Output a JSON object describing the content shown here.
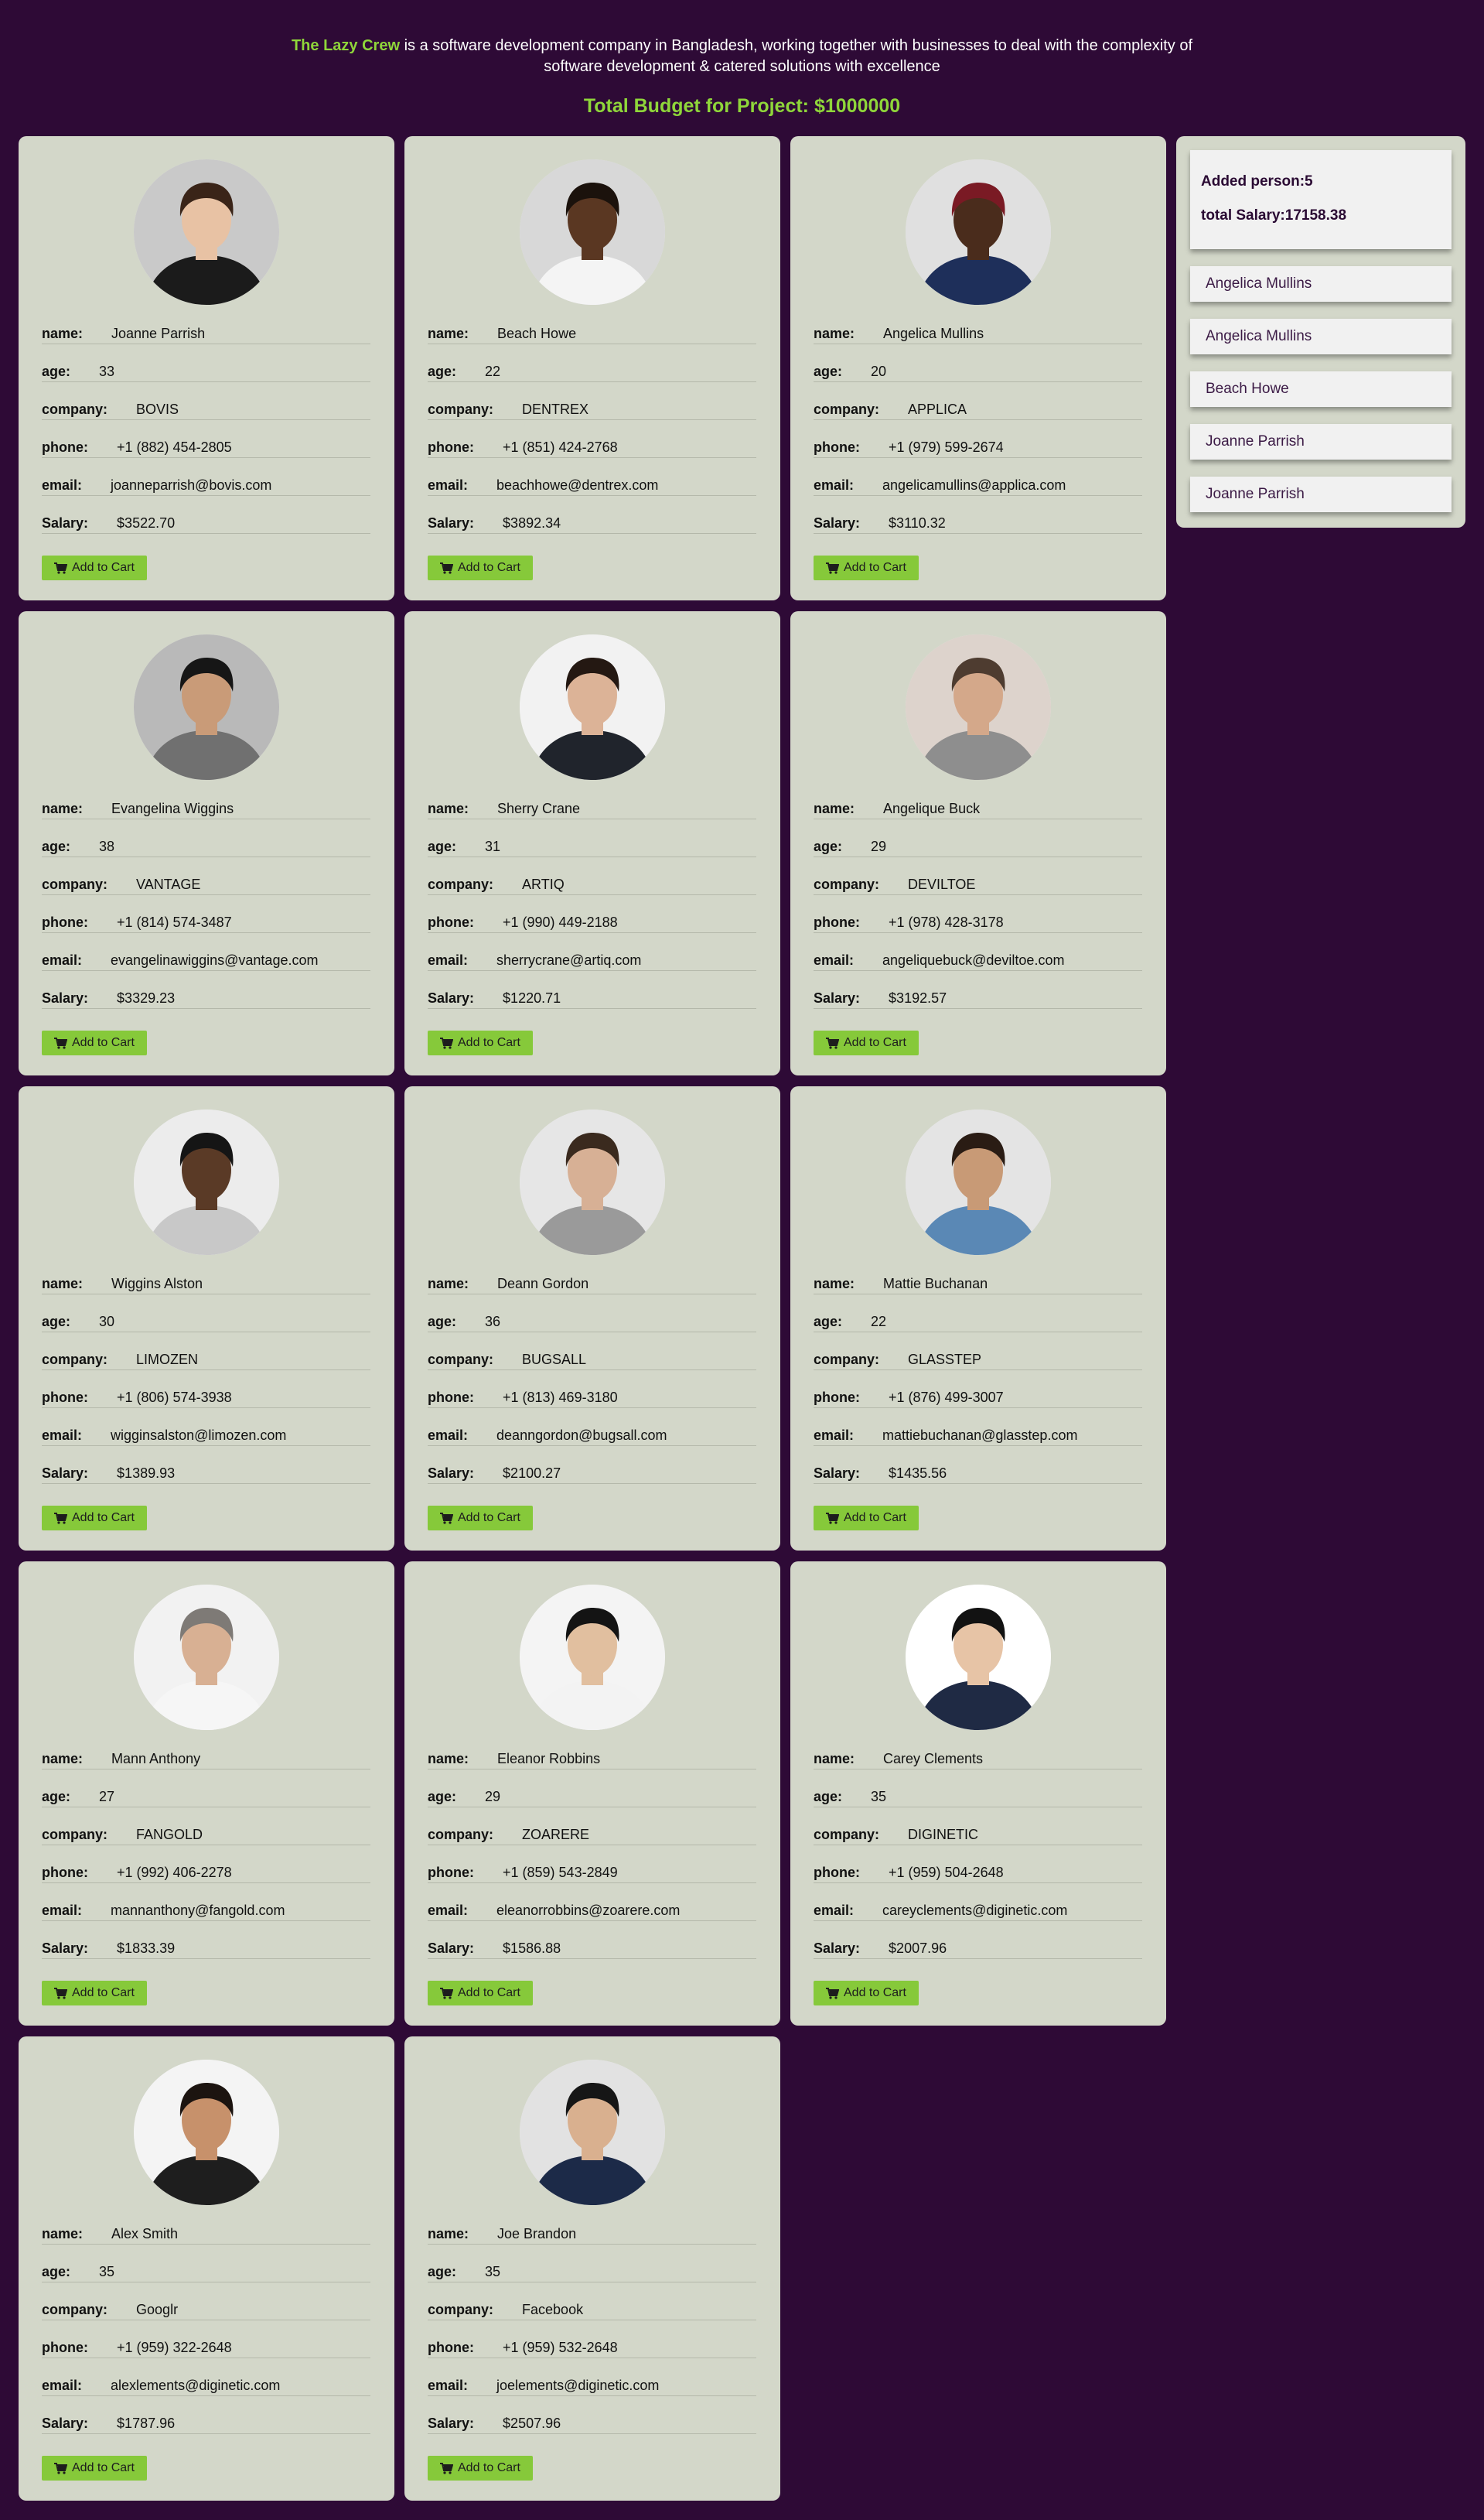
{
  "header": {
    "brand": "The Lazy Crew",
    "intro_text": " is a software development company in Bangladesh, working together with businesses to deal with the complexity of software development & catered solutions with excellence",
    "budget": "Total Budget for Project: $1000000"
  },
  "labels": {
    "name": "name:",
    "age": "age:",
    "company": "company:",
    "phone": "phone:",
    "email": "email:",
    "salary": "Salary:",
    "add_to_cart": "Add to Cart"
  },
  "people": [
    {
      "name": "Joanne Parrish",
      "age": "33",
      "company": "BOVIS",
      "phone": "+1 (882) 454-2805",
      "email": "joanneparrish@bovis.com",
      "salary": "$3522.70",
      "skin": "#e8c2a4",
      "hair": "#3a2418",
      "shirt": "#1b1b1b",
      "bg": "#c9c9c9"
    },
    {
      "name": "Beach Howe",
      "age": "22",
      "company": "DENTREX",
      "phone": "+1 (851) 424-2768",
      "email": "beachhowe@dentrex.com",
      "salary": "$3892.34",
      "skin": "#5a3722",
      "hair": "#1b120c",
      "shirt": "#f4f4f4",
      "bg": "#d8d8d8"
    },
    {
      "name": "Angelica Mullins",
      "age": "20",
      "company": "APPLICA",
      "phone": "+1 (979) 599-2674",
      "email": "angelicamullins@applica.com",
      "salary": "$3110.32",
      "skin": "#4a2c1c",
      "hair": "#7a1a24",
      "shirt": "#1e2f5a",
      "bg": "#e0e0e0"
    },
    {
      "name": "Evangelina Wiggins",
      "age": "38",
      "company": "VANTAGE",
      "phone": "+1 (814) 574-3487",
      "email": "evangelinawiggins@vantage.com",
      "salary": "$3329.23",
      "skin": "#c99b78",
      "hair": "#161616",
      "shirt": "#707070",
      "bg": "#b9b9b9"
    },
    {
      "name": "Sherry Crane",
      "age": "31",
      "company": "ARTIQ",
      "phone": "+1 (990) 449-2188",
      "email": "sherrycrane@artiq.com",
      "salary": "$1220.71",
      "skin": "#dcb397",
      "hair": "#241812",
      "shirt": "#20242c",
      "bg": "#f2f2f2"
    },
    {
      "name": "Angelique Buck",
      "age": "29",
      "company": "DEVILTOE",
      "phone": "+1 (978) 428-3178",
      "email": "angeliquebuck@deviltoe.com",
      "salary": "$3192.57",
      "skin": "#d4a88a",
      "hair": "#4e3c30",
      "shirt": "#8e8e8e",
      "bg": "#ddd3cc"
    },
    {
      "name": "Wiggins Alston",
      "age": "30",
      "company": "LIMOZEN",
      "phone": "+1 (806) 574-3938",
      "email": "wigginsalston@limozen.com",
      "salary": "$1389.93",
      "skin": "#5a3a26",
      "hair": "#151515",
      "shirt": "#c8c8c8",
      "bg": "#ececec"
    },
    {
      "name": "Deann Gordon",
      "age": "36",
      "company": "BUGSALL",
      "phone": "+1 (813) 469-3180",
      "email": "deanngordon@bugsall.com",
      "salary": "$2100.27",
      "skin": "#d7b095",
      "hair": "#3a2a1e",
      "shirt": "#9a9a9a",
      "bg": "#e6e6e6"
    },
    {
      "name": "Mattie Buchanan",
      "age": "22",
      "company": "GLASSTEP",
      "phone": "+1 (876) 499-3007",
      "email": "mattiebuchanan@glasstep.com",
      "salary": "$1435.56",
      "skin": "#c89a76",
      "hair": "#2a1c14",
      "shirt": "#5a88b5",
      "bg": "#e4e4e4"
    },
    {
      "name": "Mann Anthony",
      "age": "27",
      "company": "FANGOLD",
      "phone": "+1 (992) 406-2278",
      "email": "mannanthony@fangold.com",
      "salary": "$1833.39",
      "skin": "#d8b093",
      "hair": "#7e7a76",
      "shirt": "#f6f6f6",
      "bg": "#f2f2f2"
    },
    {
      "name": "Eleanor Robbins",
      "age": "29",
      "company": "ZOARERE",
      "phone": "+1 (859) 543-2849",
      "email": "eleanorrobbins@zoarere.com",
      "salary": "$1586.88",
      "skin": "#e1bf9f",
      "hair": "#141414",
      "shirt": "#f3f3f3",
      "bg": "#f4f4f4"
    },
    {
      "name": "Carey Clements",
      "age": "35",
      "company": "DIGINETIC",
      "phone": "+1 (959) 504-2648",
      "email": "careyclements@diginetic.com",
      "salary": "$2007.96",
      "skin": "#e7c4a6",
      "hair": "#121212",
      "shirt": "#1f2a44",
      "bg": "#ffffff"
    },
    {
      "name": "Alex Smith",
      "age": "35",
      "company": "Googlr",
      "phone": "+1 (959) 322-2648",
      "email": "alexlements@diginetic.com",
      "salary": "$1787.96",
      "skin": "#c7916b",
      "hair": "#1c1410",
      "shirt": "#1e1e1e",
      "bg": "#f4f4f4"
    },
    {
      "name": "Joe Brandon",
      "age": "35",
      "company": "Facebook",
      "phone": "+1 (959) 532-2648",
      "email": "joelements@diginetic.com",
      "salary": "$2507.96",
      "skin": "#d9b08f",
      "hair": "#161616",
      "shirt": "#1c2a48",
      "bg": "#e2e2e2"
    }
  ],
  "sidebar": {
    "added_person": "Added person:5",
    "total_salary": "total Salary:17158.38",
    "added": [
      "Angelica Mullins",
      "Angelica Mullins",
      "Beach Howe",
      "Joanne Parrish",
      "Joanne Parrish"
    ]
  },
  "colors": {
    "background": "#2e0a36",
    "accent": "#8fd63a",
    "card": "#d3d7c9",
    "button": "#86c93a"
  },
  "icons": {
    "cart": "shopping-cart-icon"
  }
}
